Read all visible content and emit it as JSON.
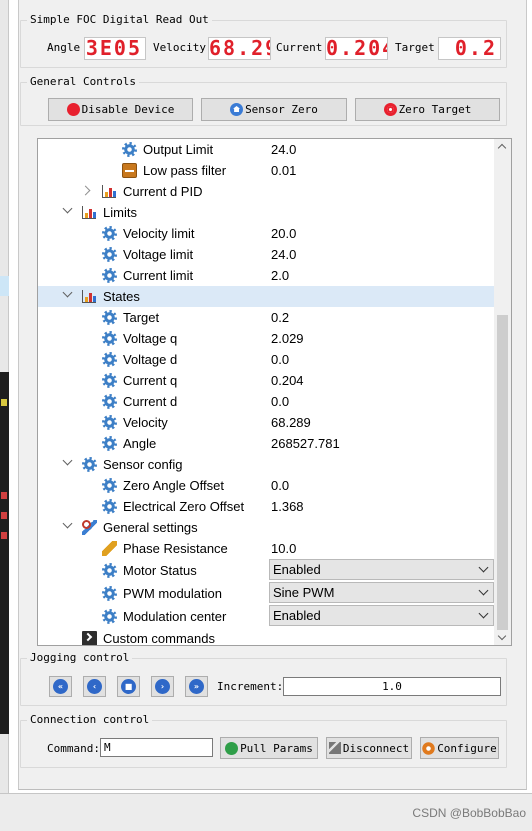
{
  "readout": {
    "title": "Simple FOC Digital Read Out",
    "angle_label": "Angle",
    "angle_value": "3E05",
    "velocity_label": "Velocity",
    "velocity_value": "68.29",
    "current_label": "Current",
    "current_value": "0.204",
    "target_label": "Target",
    "target_value": "0.2"
  },
  "general_controls": {
    "title": "General Controls",
    "disable_device": "Disable Device",
    "sensor_zero": "Sensor Zero",
    "zero_target": "Zero Target"
  },
  "tree": {
    "rows": [
      {
        "name": "Output Limit",
        "value": "24.0",
        "icon": "gear-icon"
      },
      {
        "name": "Low pass filter",
        "value": "0.01",
        "icon": "filter-icon"
      },
      {
        "name": "Current d PID",
        "value": "",
        "icon": "chart-icon"
      },
      {
        "name": "Limits",
        "value": "",
        "icon": "chart-icon"
      },
      {
        "name": "Velocity limit",
        "value": "20.0",
        "icon": "gear-icon"
      },
      {
        "name": "Voltage limit",
        "value": "24.0",
        "icon": "gear-icon"
      },
      {
        "name": "Current limit",
        "value": "2.0",
        "icon": "gear-icon"
      },
      {
        "name": "States",
        "value": "",
        "icon": "chart-icon"
      },
      {
        "name": "Target",
        "value": "0.2",
        "icon": "gear-icon"
      },
      {
        "name": "Voltage q",
        "value": "2.029",
        "icon": "gear-icon"
      },
      {
        "name": "Voltage d",
        "value": "0.0",
        "icon": "gear-icon"
      },
      {
        "name": "Current q",
        "value": "0.204",
        "icon": "gear-icon"
      },
      {
        "name": "Current d",
        "value": "0.0",
        "icon": "gear-icon"
      },
      {
        "name": "Velocity",
        "value": "68.289",
        "icon": "gear-icon"
      },
      {
        "name": "Angle",
        "value": "268527.781",
        "icon": "gear-icon"
      },
      {
        "name": "Sensor config",
        "value": "",
        "icon": "gear-icon"
      },
      {
        "name": "Zero Angle Offset",
        "value": "0.0",
        "icon": "gear-icon"
      },
      {
        "name": "Electrical Zero Offset",
        "value": "1.368",
        "icon": "gear-icon"
      },
      {
        "name": "General settings",
        "value": "",
        "icon": "wrench-icon"
      },
      {
        "name": "Phase Resistance",
        "value": "10.0",
        "icon": "pen-icon"
      },
      {
        "name": "Motor Status",
        "value": "Enabled",
        "icon": "gear-icon"
      },
      {
        "name": "PWM modulation",
        "value": "Sine PWM",
        "icon": "gear-icon"
      },
      {
        "name": "Modulation center",
        "value": "Enabled",
        "icon": "gear-icon"
      },
      {
        "name": "Custom commands",
        "value": "",
        "icon": "terminal-icon"
      }
    ]
  },
  "jogging": {
    "title": "Jogging control",
    "increment_label": "Increment:",
    "increment_value": "1.0"
  },
  "connection": {
    "title": "Connection control",
    "command_label": "Command:",
    "command_value": "M",
    "pull_params": "Pull Params",
    "disconnect": "Disconnect",
    "configure": "Configure"
  },
  "watermark": "CSDN @BobBobBao",
  "colors": {
    "lcd_digits": "#e0202a",
    "accent_blue": "#3d7fc6",
    "selection": "#dbe9f7"
  }
}
